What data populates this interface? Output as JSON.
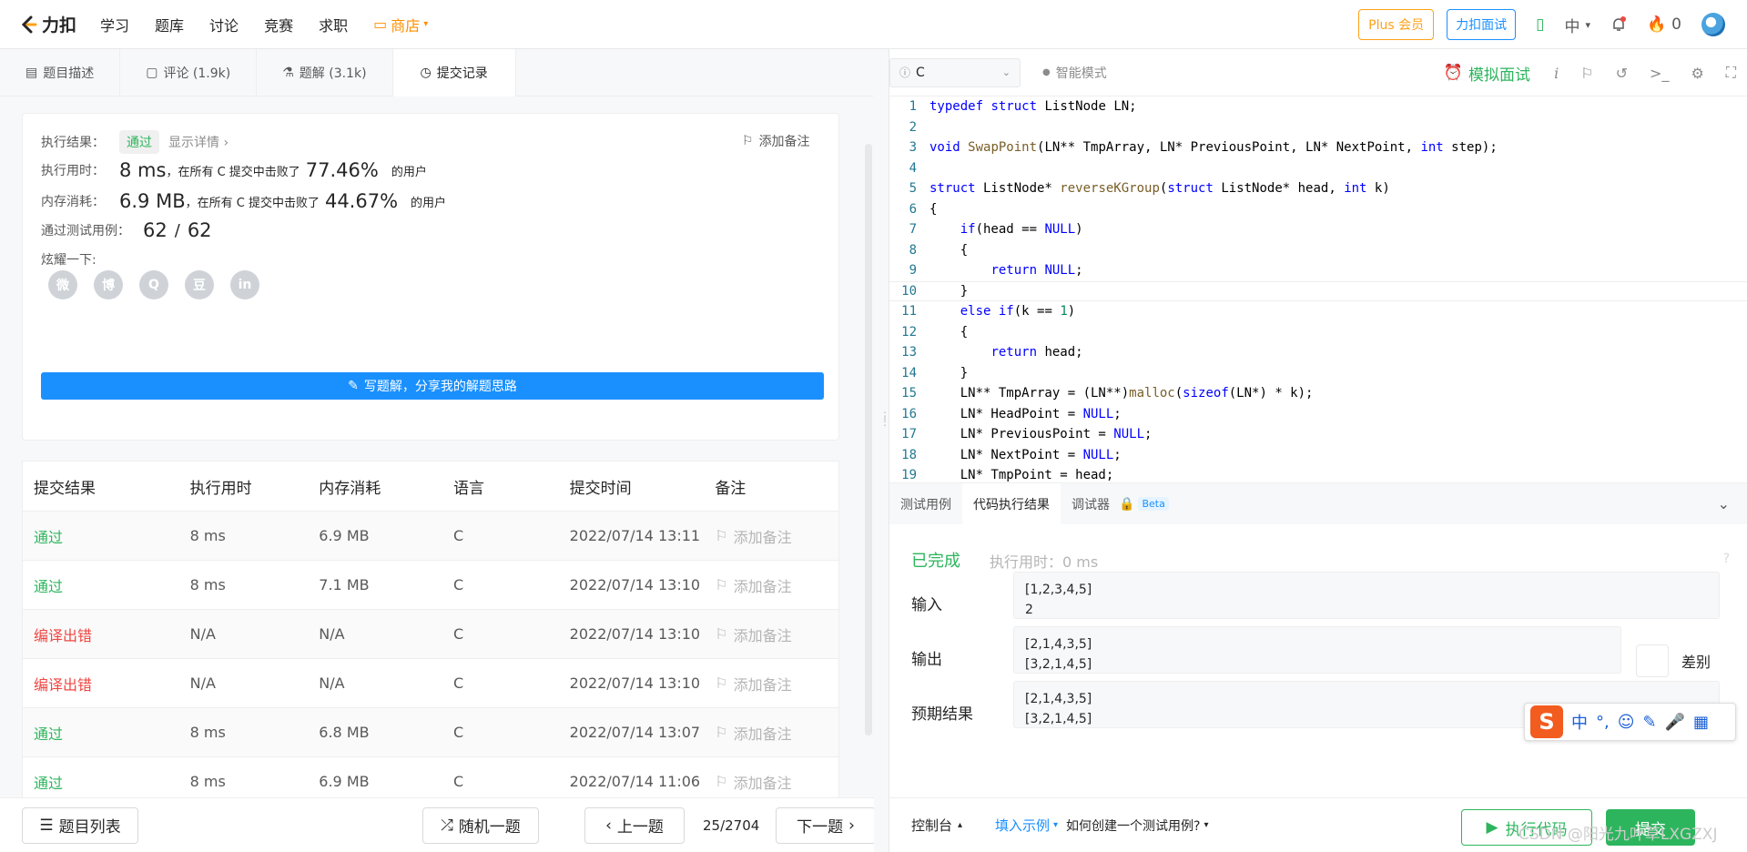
{
  "topnav": {
    "brand": "力扣",
    "items": [
      "学习",
      "题库",
      "讨论",
      "竞赛",
      "求职"
    ],
    "shop": "商店",
    "plus": "Plus 会员",
    "interview": "力扣面试",
    "lang": "中",
    "streak": "0"
  },
  "left": {
    "tabs": [
      "题目描述",
      "评论 (1.9k)",
      "题解 (3.1k)",
      "提交记录"
    ],
    "result": {
      "label": "执行结果：",
      "status": "通过",
      "detail": "显示详情 ›",
      "add_note": "添加备注",
      "runtime_label": "执行用时：",
      "runtime_value": "8 ms",
      "runtime_text": "，在所有 C 提交中击败了",
      "runtime_pct": "77.46%",
      "users": "的用户",
      "memory_label": "内存消耗：",
      "memory_value": "6.9 MB",
      "memory_text": "，在所有 C 提交中击败了",
      "memory_pct": "44.67%",
      "tests_label": "通过测试用例：",
      "tests_pass": "62",
      "tests_sep": "/",
      "tests_total": "62",
      "share_label": "炫耀一下:",
      "share_icons": [
        "微",
        "博",
        "Q",
        "豆",
        "in"
      ],
      "write_btn": "写题解，分享我的解题思路"
    },
    "table": {
      "headers": [
        "提交结果",
        "执行用时",
        "内存消耗",
        "语言",
        "提交时间",
        "备注"
      ],
      "rows": [
        {
          "status": "通过",
          "kind": "ok",
          "time": "8 ms",
          "mem": "6.9 MB",
          "lang": "C",
          "date": "2022/07/14 13:11",
          "note": "添加备注"
        },
        {
          "status": "通过",
          "kind": "ok",
          "time": "8 ms",
          "mem": "7.1 MB",
          "lang": "C",
          "date": "2022/07/14 13:10",
          "note": "添加备注"
        },
        {
          "status": "编译出错",
          "kind": "err",
          "time": "N/A",
          "mem": "N/A",
          "lang": "C",
          "date": "2022/07/14 13:10",
          "note": "添加备注"
        },
        {
          "status": "编译出错",
          "kind": "err",
          "time": "N/A",
          "mem": "N/A",
          "lang": "C",
          "date": "2022/07/14 13:10",
          "note": "添加备注"
        },
        {
          "status": "通过",
          "kind": "ok",
          "time": "8 ms",
          "mem": "6.8 MB",
          "lang": "C",
          "date": "2022/07/14 13:07",
          "note": "添加备注"
        },
        {
          "status": "通过",
          "kind": "ok",
          "time": "8 ms",
          "mem": "6.9 MB",
          "lang": "C",
          "date": "2022/07/14 11:06",
          "note": "添加备注"
        }
      ]
    },
    "footer": {
      "list": "题目列表",
      "random": "随机一题",
      "prev": "上一题",
      "page": "25/2704",
      "next": "下一题"
    }
  },
  "right": {
    "lang": "C",
    "smart": "智能模式",
    "mock": "模拟面试",
    "code_lines": [
      "typedef struct ListNode LN;",
      "",
      "void SwapPoint(LN** TmpArray, LN* PreviousPoint, LN* NextPoint, int step);",
      "",
      "struct ListNode* reverseKGroup(struct ListNode* head, int k)",
      "{",
      "    if(head == NULL)",
      "    {",
      "        return NULL;",
      "    }",
      "    else if(k == 1)",
      "    {",
      "        return head;",
      "    }",
      "    LN** TmpArray = (LN**)malloc(sizeof(LN*) * k);",
      "    LN* HeadPoint = NULL;",
      "    LN* PreviousPoint = NULL;",
      "    LN* NextPoint = NULL;",
      "    LN* TmpPoint = head;"
    ],
    "console_tabs": [
      "测试用例",
      "代码执行结果",
      "调试器",
      "Beta"
    ],
    "result": {
      "done": "已完成",
      "time": "执行用时：0 ms",
      "input_label": "输入",
      "input": [
        "[1,2,3,4,5]",
        "2"
      ],
      "output_label": "输出",
      "output": [
        "[2,1,4,3,5]",
        "[3,2,1,4,5]"
      ],
      "diff": "差别",
      "expected_label": "预期结果",
      "expected": [
        "[2,1,4,3,5]",
        "[3,2,1,4,5]"
      ]
    },
    "footer": {
      "console": "控制台",
      "fill": "填入示例",
      "how": "如何创建一个测试用例?",
      "run": "执行代码",
      "submit": "提交"
    }
  },
  "ime": {
    "items": [
      "中",
      "°,",
      "☺",
      "✎",
      "🎤",
      "▦"
    ]
  },
  "watermark": "CSDN @阳光九叶草LXGZXJ"
}
